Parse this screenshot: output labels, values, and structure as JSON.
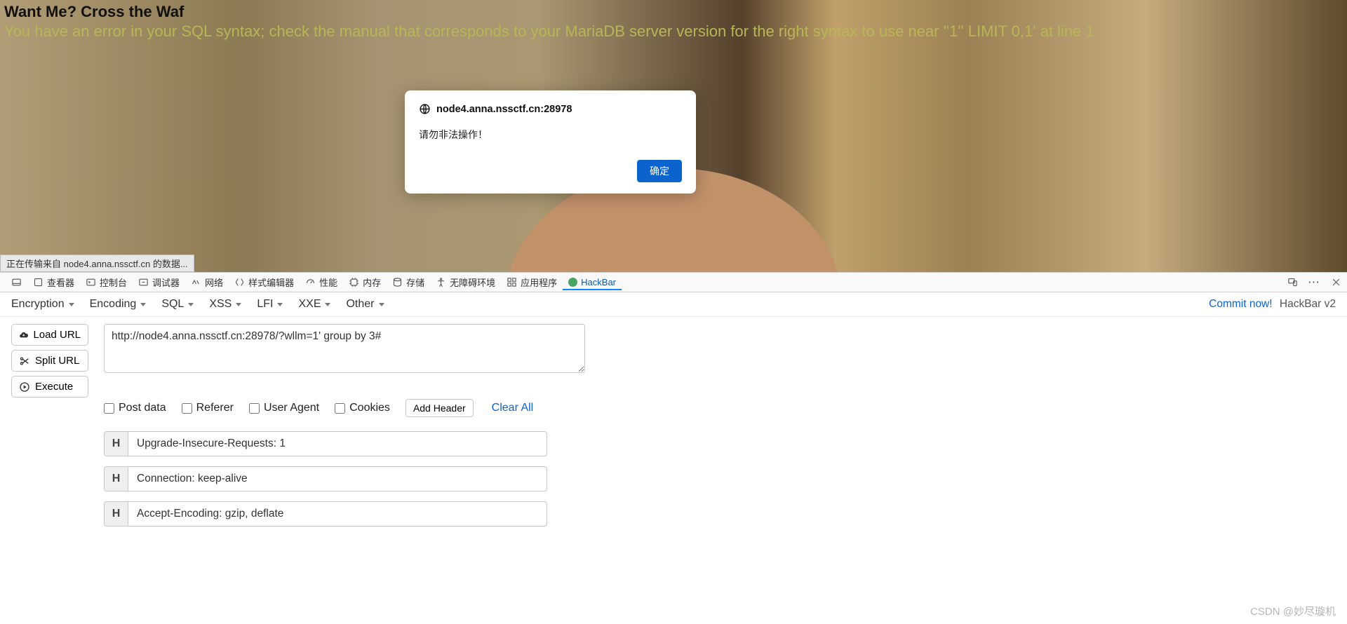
{
  "page": {
    "title": "Want Me? Cross the Waf",
    "error": "You have an error in your SQL syntax; check the manual that corresponds to your MariaDB server version for the right syntax to use near ''1'' LIMIT 0,1' at line 1",
    "status_text": "正在传输来自 node4.anna.nssctf.cn 的数据..."
  },
  "modal": {
    "host": "node4.anna.nssctf.cn:28978",
    "message": "请勿非法操作！",
    "ok_label": "确定"
  },
  "devtools": {
    "tabs": [
      "查看器",
      "控制台",
      "调试器",
      "网络",
      "样式编辑器",
      "性能",
      "内存",
      "存储",
      "无障碍环境",
      "应用程序",
      "HackBar"
    ],
    "active_index": 10
  },
  "hackbar": {
    "menus": [
      "Encryption",
      "Encoding",
      "SQL",
      "XSS",
      "LFI",
      "XXE",
      "Other"
    ],
    "commit_link": "Commit now!",
    "brand": "HackBar v2",
    "buttons": {
      "load": "Load URL",
      "split": "Split URL",
      "execute": "Execute"
    },
    "url": "http://node4.anna.nssctf.cn:28978/?wllm=1' group by 3#",
    "checks": {
      "post": "Post data",
      "referer": "Referer",
      "ua": "User Agent",
      "cookies": "Cookies"
    },
    "add_header_label": "Add Header",
    "clear_label": "Clear All",
    "headers": [
      "Upgrade-Insecure-Requests: 1",
      "Connection: keep-alive",
      "Accept-Encoding: gzip, deflate"
    ]
  },
  "watermark": "CSDN @妙尽璇机"
}
